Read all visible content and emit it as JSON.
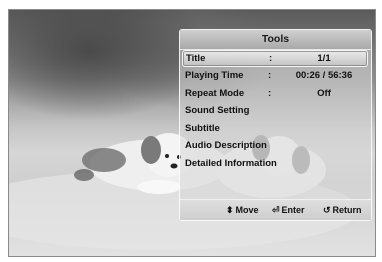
{
  "tools_menu": {
    "title": "Tools",
    "items": [
      {
        "label": "Title",
        "separator": ":",
        "value": "1/1",
        "selected": true
      },
      {
        "label": "Playing Time",
        "separator": ":",
        "value": "00:26 / 56:36",
        "selected": false
      },
      {
        "label": "Repeat Mode",
        "separator": ":",
        "value": "Off",
        "selected": false
      },
      {
        "label": "Sound Setting",
        "separator": "",
        "value": "",
        "selected": false
      },
      {
        "label": "Subtitle",
        "separator": "",
        "value": "",
        "selected": false
      },
      {
        "label": "Audio Description",
        "separator": "",
        "value": "",
        "selected": false
      },
      {
        "label": "Detailed Information",
        "separator": "",
        "value": "",
        "selected": false
      }
    ],
    "footer": {
      "move": {
        "icon": "up-down-arrows-icon",
        "glyph": "⬍",
        "label": "Move"
      },
      "enter": {
        "icon": "enter-key-icon",
        "glyph": "⏎",
        "label": "Enter"
      },
      "return": {
        "icon": "return-arrow-icon",
        "glyph": "↺",
        "label": "Return"
      }
    }
  },
  "colors": {
    "panel_bg": "#d7d7d7",
    "text": "#111111",
    "highlight_border": "#f5f5f5"
  }
}
